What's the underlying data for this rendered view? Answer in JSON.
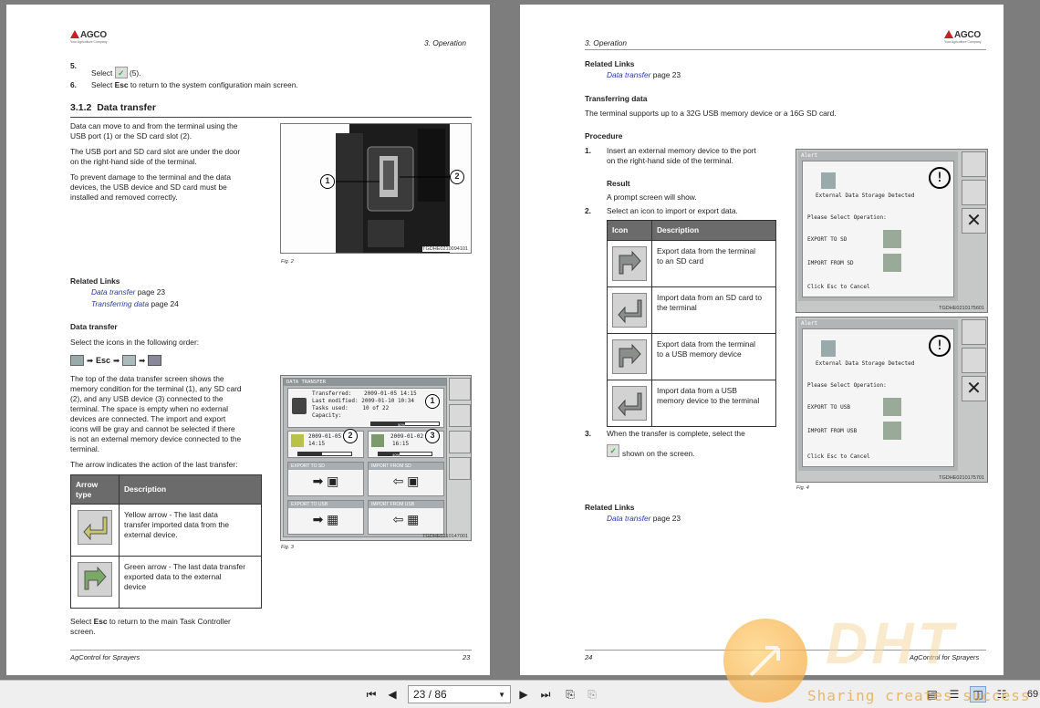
{
  "colors": {
    "accent_red": "#c8202a",
    "link": "#2a3f9c",
    "table_header": "#6b6b6b",
    "watermark": "#f4a53b"
  },
  "left_page": {
    "logo": {
      "brand": "AGCO",
      "tagline": "Your Agriculture Company"
    },
    "header_section": "3. Operation",
    "step5": {
      "num": "5.",
      "pre": "Select",
      "post": "(5)."
    },
    "step6": {
      "num": "6.",
      "pre": "Select",
      "key": "Esc",
      "post": "to return to the system configuration main screen."
    },
    "section_num": "3.1.2",
    "section_title": "Data transfer",
    "para1": [
      "Data can move to and from the terminal using the",
      "USB port (1) or the SD card slot (2)."
    ],
    "para2": [
      "The USB port and SD card slot are under the door",
      "on the right-hand side of the terminal."
    ],
    "para3": [
      "To prevent damage to the terminal and the data",
      "devices, the USB device and SD card must be",
      "installed and removed correctly."
    ],
    "fig2": {
      "caption": "Fig. 2",
      "code": "TGDHE0210094101",
      "callouts": [
        "1",
        "2"
      ]
    },
    "related_title": "Related Links",
    "related_links": [
      {
        "text": "Data transfer",
        "page": "page 23"
      },
      {
        "text": "Transferring data",
        "page": "page 24"
      }
    ],
    "sub_title": "Data transfer",
    "select_text": "Select the icons in the following order:",
    "esc_label": "Esc",
    "para4": [
      "The top of the data transfer screen shows the",
      "memory condition for the terminal (1), any SD card",
      "(2), and any USB device (3) connected to the",
      "terminal. The space is empty when no external",
      "devices are connected. The import and export",
      "icons will be gray and cannot be selected if there",
      "is not an external memory device connected to the",
      "terminal."
    ],
    "para5": "The arrow indicates the action of the last transfer:",
    "fig3": {
      "caption": "Fig. 3",
      "code": "TGDHE0210147001",
      "title": "DATA TRANSFER",
      "rows": [
        [
          "Transferred:",
          "2009-01-05 14:15"
        ],
        [
          "Last modified:",
          "2009-01-10 10:34"
        ],
        [
          "Tasks used:",
          "10 of 22"
        ],
        [
          "Capacity:",
          ""
        ]
      ],
      "sd": [
        "2009-01-05",
        "14:15"
      ],
      "usb": [
        "2009-01-02",
        "16:15"
      ],
      "buttons": [
        "EXPORT TO SD",
        "IMPORT FROM SD",
        "EXPORT TO USB",
        "IMPORT FROM USB"
      ],
      "callouts": [
        "1",
        "2",
        "3"
      ],
      "percent_main": "50%",
      "percent_usb": "40%"
    },
    "table": {
      "headers": [
        "Arrow type",
        "Description"
      ],
      "rows": [
        {
          "bold": "Yellow arrow -",
          "text": [
            "The last data",
            "transfer imported data from the",
            "external device."
          ]
        },
        {
          "bold": "Green arrow -",
          "text": [
            "The last data transfer",
            "exported data to the external",
            "device"
          ]
        }
      ]
    },
    "final": {
      "pre": "Select",
      "key": "Esc",
      "post": "to return to the main Task Controller",
      "line2": "screen."
    },
    "footer_title": "AgControl for Sprayers",
    "footer_page": "23"
  },
  "right_page": {
    "logo": {
      "brand": "AGCO",
      "tagline": "Your Agriculture Company"
    },
    "header_section": "3. Operation",
    "related_title": "Related Links",
    "related_link": {
      "text": "Data transfer",
      "page": "page 23"
    },
    "transfer_title": "Transferring data",
    "transfer_text": "The terminal supports up to a 32G USB memory device or a 16G SD card.",
    "procedure_title": "Procedure",
    "step1": {
      "num": "1.",
      "text": [
        "Insert an external memory device to the port",
        "on the right-hand side of the terminal."
      ]
    },
    "result_title": "Result",
    "result_text": "A prompt screen will show.",
    "step2": {
      "num": "2.",
      "text": "Select an icon to import or export data."
    },
    "table": {
      "headers": [
        "Icon",
        "Description"
      ],
      "rows": [
        [
          "Export data from the terminal",
          "to an SD card"
        ],
        [
          "Import data from an SD card to",
          "the terminal"
        ],
        [
          "Export data from the terminal",
          "to a USB memory device"
        ],
        [
          "Import data from a USB",
          "memory device to the terminal"
        ]
      ]
    },
    "step3": {
      "num": "3.",
      "text": "When the transfer is complete, select the",
      "text2": "shown on the screen."
    },
    "fig4": {
      "caption": "Fig. 4",
      "top": {
        "title": "Alert",
        "detected": "External Data Storage Detected",
        "select": "Please Select Operation:",
        "opt1": "EXPORT TO SD",
        "opt2": "IMPORT FROM SD",
        "cancel": "Click Esc to Cancel",
        "code": "TGDHE0210175601"
      },
      "bottom": {
        "title": "Alert",
        "detected": "External Data Storage Detected",
        "select": "Please Select Operation:",
        "opt1": "EXPORT TO USB",
        "opt2": "IMPORT FROM USB",
        "cancel": "Click Esc to Cancel",
        "code": "TGDHE0210175701"
      }
    },
    "related2_title": "Related Links",
    "related2_link": {
      "text": "Data transfer",
      "page": "page 23"
    },
    "footer_title": "AgControl for Sprayers",
    "footer_page": "24"
  },
  "toolbar": {
    "page_display": "23 / 86",
    "zoom_partial": "69"
  },
  "watermark": {
    "logo_text": "DHT",
    "tagline": "Sharing creates success"
  }
}
